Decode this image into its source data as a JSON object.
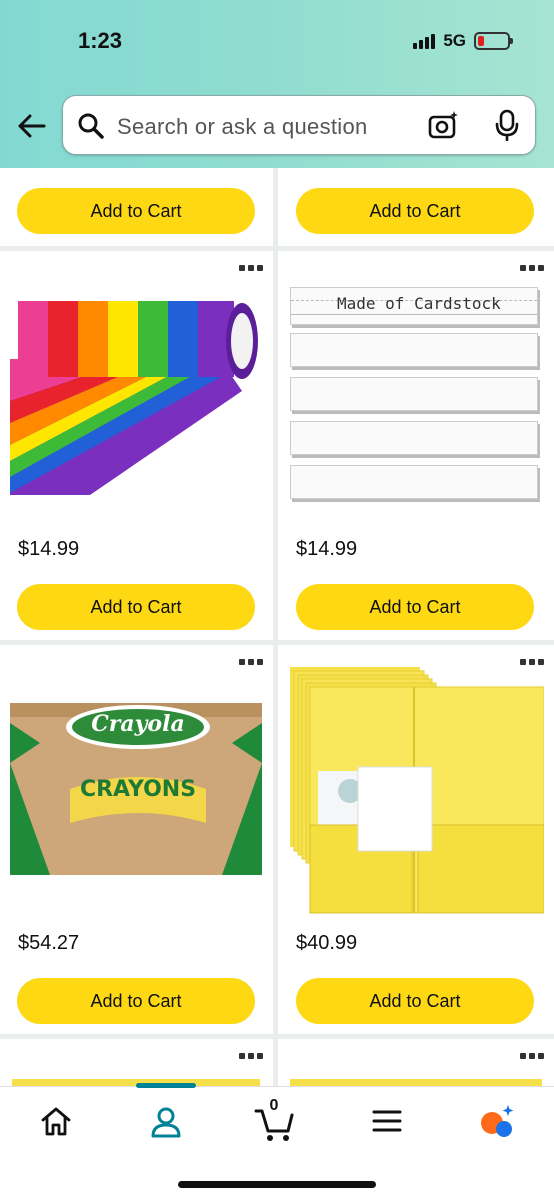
{
  "status_bar": {
    "time": "1:23",
    "network": "5G"
  },
  "search": {
    "placeholder": "Search or ask a question"
  },
  "products": [
    {
      "price": "",
      "button": "Add to Cart"
    },
    {
      "price": "",
      "button": "Add to Cart"
    },
    {
      "image": "rainbow-tape-rolls",
      "price": "$14.99",
      "button": "Add to Cart"
    },
    {
      "image": "sentence-strips",
      "image_text": "Made of Cardstock",
      "price": "$14.99",
      "button": "Add to Cart"
    },
    {
      "image": "crayola-crayons-classpack",
      "image_text": "Crayola",
      "image_text2": "CRAYONS",
      "price": "$54.27",
      "button": "Add to Cart"
    },
    {
      "image": "yellow-pocket-folders",
      "price": "$40.99",
      "button": "Add to Cart"
    }
  ],
  "bottom_nav": {
    "cart_count": "0",
    "active": "account"
  },
  "colors": {
    "accent": "#ffd814",
    "nav_active": "#008296",
    "header": "#8fdcd0"
  }
}
